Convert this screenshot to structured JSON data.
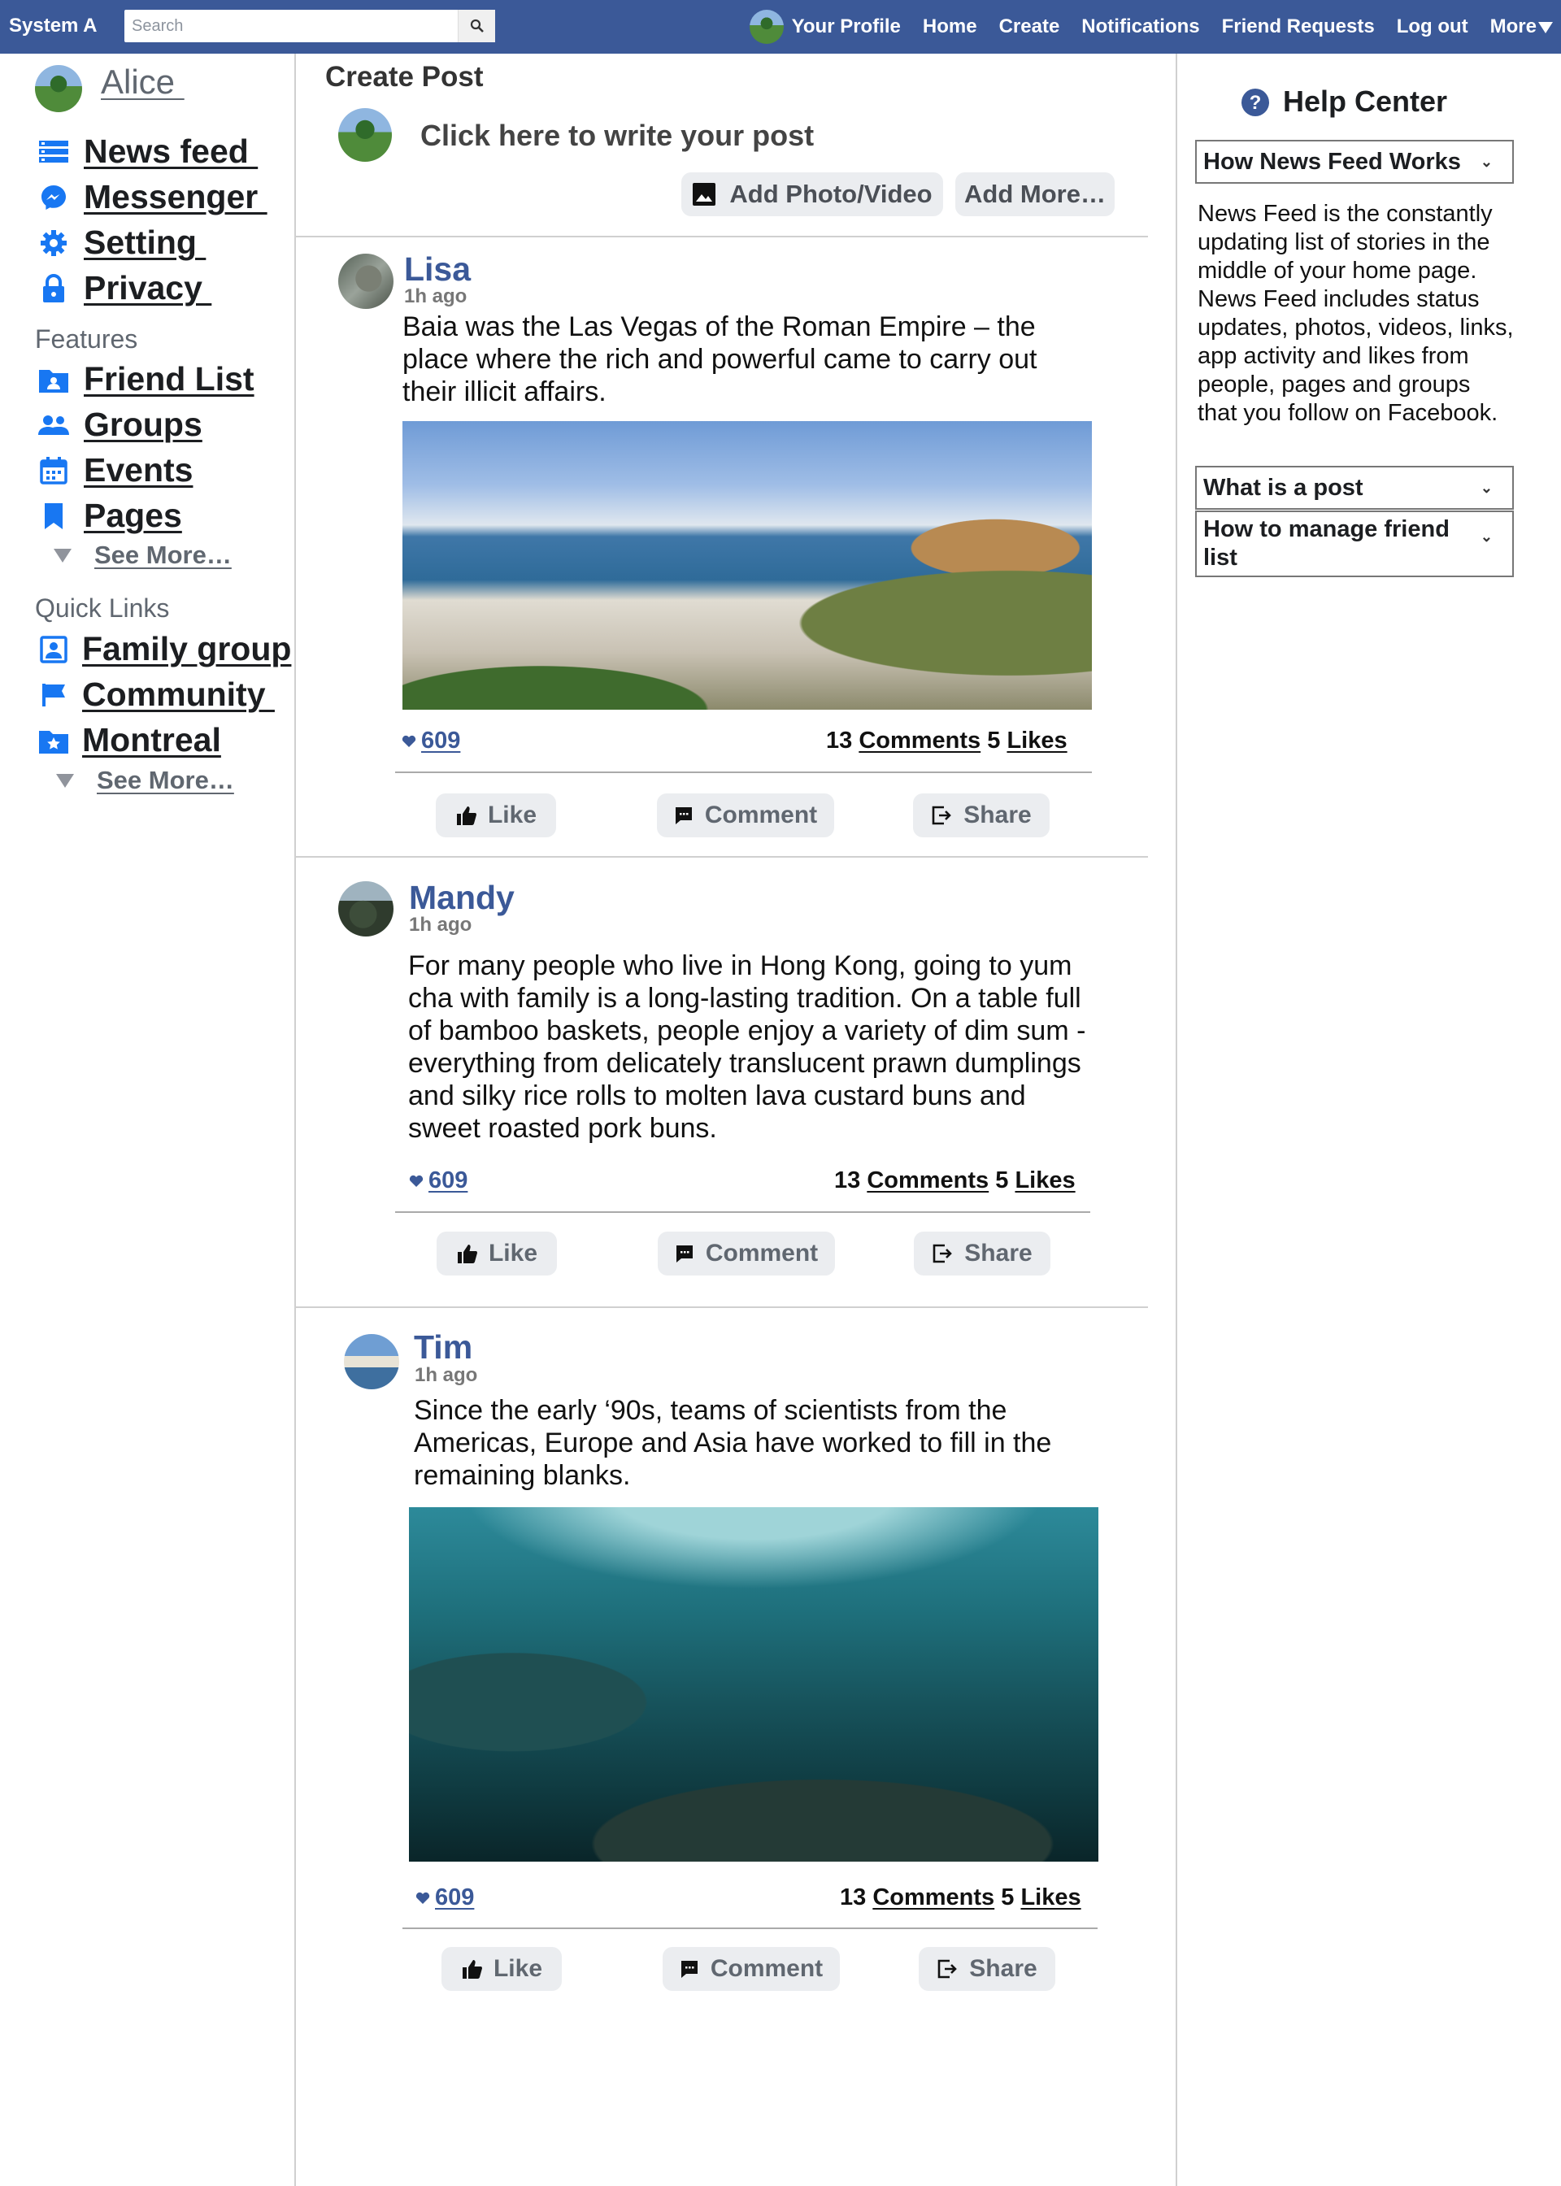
{
  "topbar": {
    "brand": "System A",
    "search_placeholder": "Search",
    "nav": [
      "Your Profile",
      "Home",
      "Create",
      "Notifications",
      "Friend Requests",
      "Log out",
      "More"
    ]
  },
  "sidebar": {
    "profile_name": "Alice ",
    "main_items": [
      {
        "label": "News feed ",
        "icon": "news-feed-icon"
      },
      {
        "label": "Messenger ",
        "icon": "messenger-icon"
      },
      {
        "label": "Setting ",
        "icon": "gear-icon"
      },
      {
        "label": "Privacy ",
        "icon": "lock-icon"
      }
    ],
    "features_heading": "Features",
    "features": [
      {
        "label": "Friend List",
        "icon": "friend-list-icon"
      },
      {
        "label": "Groups",
        "icon": "groups-icon"
      },
      {
        "label": "Events",
        "icon": "calendar-icon"
      },
      {
        "label": "Pages",
        "icon": "bookmark-icon"
      }
    ],
    "see_more": "See More…",
    "quick_links_heading": "Quick Links",
    "quick_links": [
      {
        "label": "Family group",
        "icon": "contact-icon"
      },
      {
        "label": "Community ",
        "icon": "flag-icon"
      },
      {
        "label": "Montreal",
        "icon": "star-folder-icon"
      }
    ],
    "see_more_2": "See More…"
  },
  "create_post": {
    "title": "Create Post",
    "prompt": "Click here to write your post",
    "add_photo": "Add Photo/Video",
    "add_more": "Add More…"
  },
  "posts": [
    {
      "author": "Lisa",
      "time": "1h ago",
      "text": "Baia was the Las Vegas of the Roman Empire – the place where the rich and powerful came to carry out their illicit affairs.",
      "reactions": "609",
      "comments_count": "13",
      "comments_label": "Comments",
      "likes_count": "5",
      "likes_label": "Likes",
      "like": "Like",
      "comment": "Comment",
      "share": "Share"
    },
    {
      "author": "Mandy",
      "time": "1h ago",
      "text": "For many people who live in Hong Kong, going to yum cha with family is a long-lasting tradition.  On a table full of bamboo baskets, people enjoy a variety of dim sum - everything from delicately translucent prawn dumplings and silky rice rolls to molten lava custard buns and sweet roasted pork buns.",
      "reactions": "609",
      "comments_count": "13",
      "comments_label": "Comments",
      "likes_count": "5",
      "likes_label": "Likes",
      "like": "Like",
      "comment": "Comment",
      "share": "Share"
    },
    {
      "author": "Tim",
      "time": "1h ago",
      "text": "Since the early ‘90s, teams of scientists from the Americas, Europe and Asia have worked to fill in the remaining blanks.",
      "reactions": "609",
      "comments_count": "13",
      "comments_label": "Comments",
      "likes_count": "5",
      "likes_label": "Likes",
      "like": "Like",
      "comment": "Comment",
      "share": "Share"
    }
  ],
  "help_center": {
    "title": "Help Center",
    "accordions": [
      "How News Feed Works",
      "What is a post",
      "How to manage friend list"
    ],
    "body": "News Feed is the constantly updating list of stories in the middle of your home page. News Feed includes status updates, photos, videos, links, app activity and likes from people, pages and groups that you follow on Facebook."
  },
  "colors": {
    "topbar": "#3b5998",
    "icon_blue": "#1877f2",
    "author_blue": "#3b5998"
  }
}
